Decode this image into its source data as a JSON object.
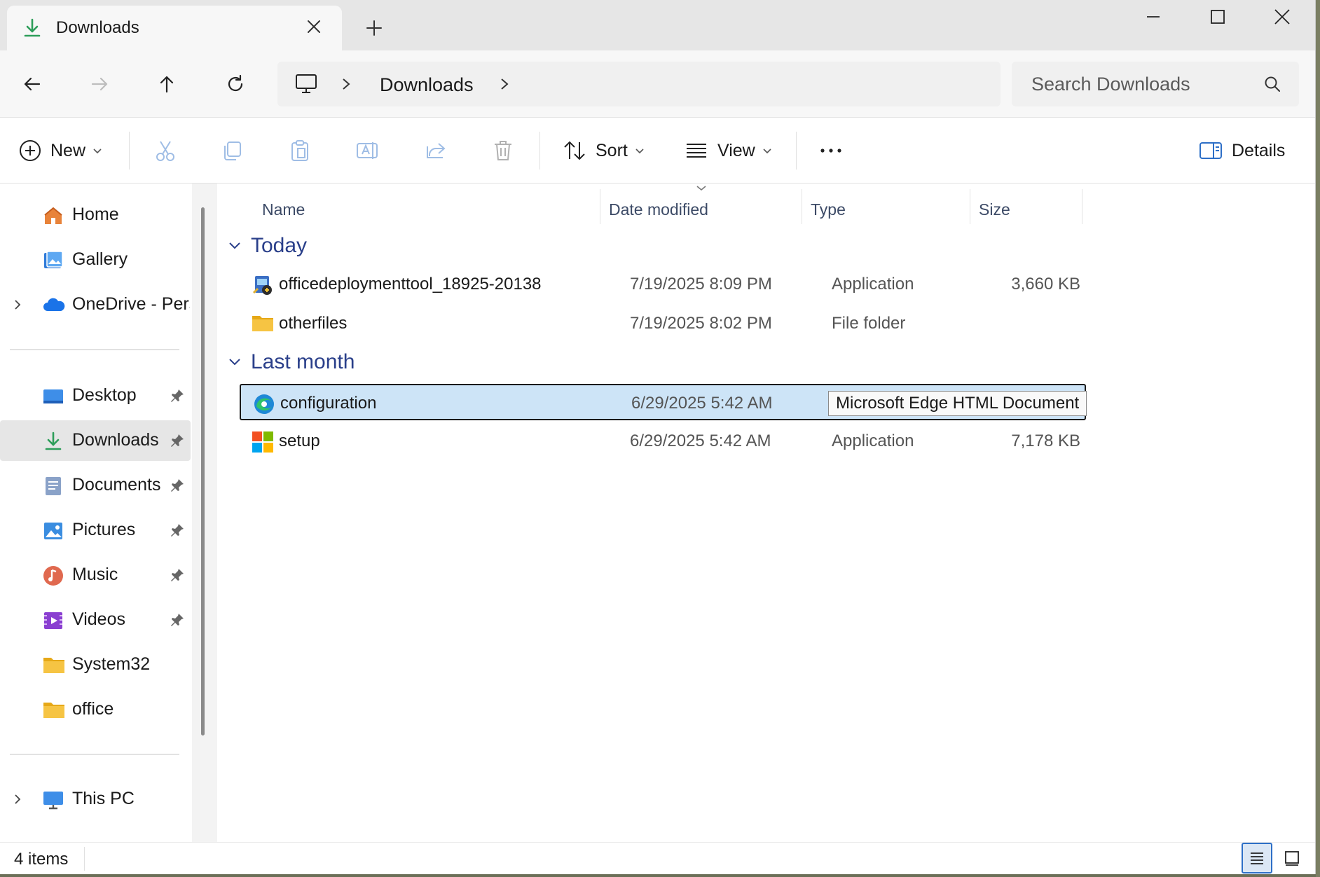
{
  "window": {
    "tab_title": "Downloads"
  },
  "nav": {
    "breadcrumb_current": "Downloads",
    "search_placeholder": "Search Downloads"
  },
  "commands": {
    "new_label": "New",
    "sort_label": "Sort",
    "view_label": "View",
    "details_label": "Details"
  },
  "sidebar": {
    "top_items": [
      {
        "label": "Home",
        "icon": "home-icon"
      },
      {
        "label": "Gallery",
        "icon": "gallery-icon"
      },
      {
        "label": "OneDrive - Persı",
        "icon": "onedrive-icon"
      }
    ],
    "quick_access": [
      {
        "label": "Desktop",
        "icon": "desktop-icon",
        "pinned": true
      },
      {
        "label": "Downloads",
        "icon": "downloads-icon",
        "pinned": true,
        "selected": true
      },
      {
        "label": "Documents",
        "icon": "documents-icon",
        "pinned": true
      },
      {
        "label": "Pictures",
        "icon": "pictures-icon",
        "pinned": true
      },
      {
        "label": "Music",
        "icon": "music-icon",
        "pinned": true
      },
      {
        "label": "Videos",
        "icon": "videos-icon",
        "pinned": true
      },
      {
        "label": "System32",
        "icon": "folder-icon",
        "pinned": false
      },
      {
        "label": "office",
        "icon": "folder-icon",
        "pinned": false
      }
    ],
    "bottom_items": [
      {
        "label": "This PC",
        "icon": "this-pc-icon"
      }
    ]
  },
  "columns": {
    "name": "Name",
    "date": "Date modified",
    "type": "Type",
    "size": "Size"
  },
  "groups": [
    {
      "label": "Today",
      "files": [
        {
          "name": "officedeploymenttool_18925-20138",
          "date": "7/19/2025 8:09 PM",
          "type": "Application",
          "size": "3,660 KB",
          "icon": "installer-icon"
        },
        {
          "name": "otherfiles",
          "date": "7/19/2025 8:02 PM",
          "type": "File folder",
          "size": "",
          "icon": "folder-icon"
        }
      ]
    },
    {
      "label": "Last month",
      "files": [
        {
          "name": "configuration",
          "date": "6/29/2025 5:42 AM",
          "type": "",
          "size": "",
          "icon": "edge-icon",
          "selected": true,
          "tooltip": "Microsoft Edge HTML Document"
        },
        {
          "name": "setup",
          "date": "6/29/2025 5:42 AM",
          "type": "Application",
          "size": "7,178 KB",
          "icon": "windows-app-icon"
        }
      ]
    }
  ],
  "status": {
    "item_count": "4 items"
  },
  "colors": {
    "accent": "#2d6fc7",
    "group_header": "#2a3f8a",
    "selection": "#cde4f7",
    "folder": "#f6c443"
  }
}
